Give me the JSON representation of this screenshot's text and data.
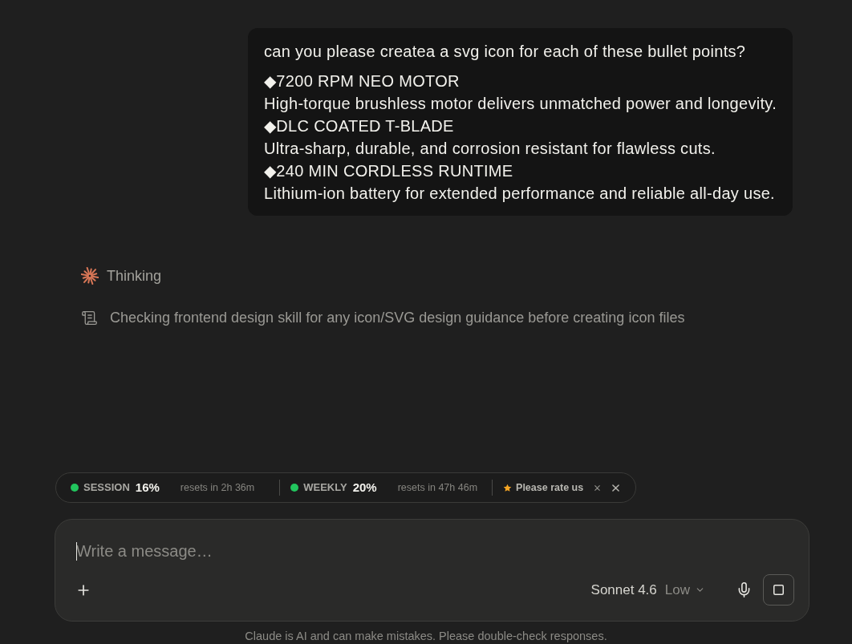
{
  "user_message": {
    "intro": "can you please createa a svg icon for each of these bullet points?",
    "bullets": [
      {
        "title": "◆7200 RPM NEO MOTOR",
        "description": "High-torque brushless motor delivers unmatched power and longevity."
      },
      {
        "title": "◆DLC COATED T-BLADE",
        "description": "Ultra-sharp, durable, and corrosion resistant for flawless cuts."
      },
      {
        "title": "◆240 MIN CORDLESS RUNTIME",
        "description": "Lithium-ion battery for extended performance and reliable all-day use."
      }
    ]
  },
  "activity": [
    {
      "kind": "thinking",
      "text": "Thinking"
    },
    {
      "kind": "tool",
      "text": "Checking frontend design skill for any icon/SVG design guidance before creating icon files"
    }
  ],
  "usage_bar": {
    "meters": [
      {
        "label": "SESSION",
        "percent": "16%",
        "reset": "resets in 2h 36m",
        "color": "#22c55e"
      },
      {
        "label": "WEEKLY",
        "percent": "20%",
        "reset": "resets in 47h 46m",
        "color": "#22c55e"
      }
    ],
    "rating": {
      "label": "Please rate us"
    }
  },
  "composer": {
    "placeholder": "Write a message…",
    "model": "Sonnet 4.6",
    "effort": "Low"
  },
  "disclaimer": "Claude is AI and can make mistakes. Please double-check responses."
}
